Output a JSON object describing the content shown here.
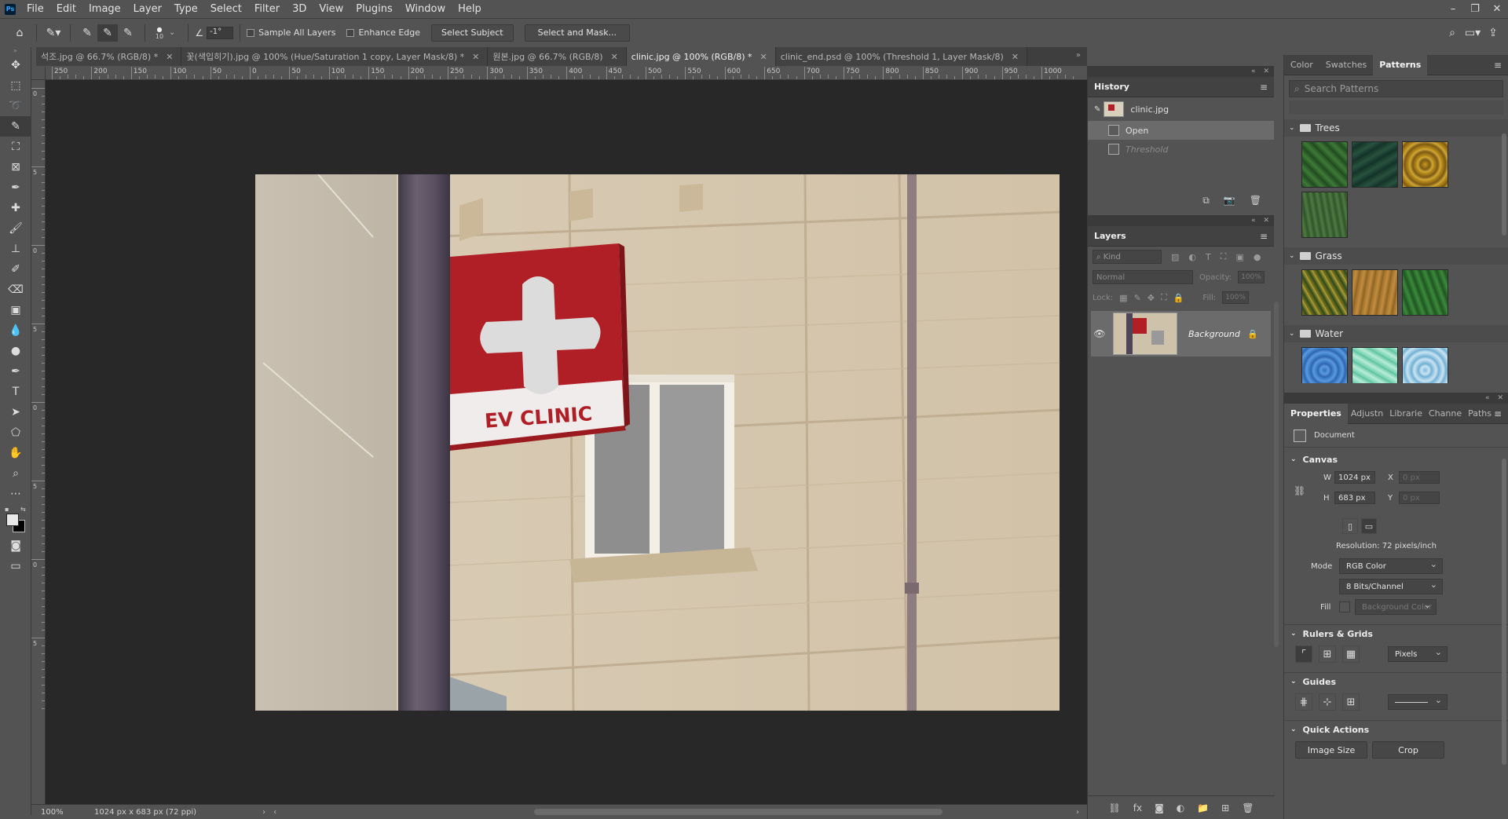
{
  "app": {
    "logo": "Ps"
  },
  "menu": [
    "File",
    "Edit",
    "Image",
    "Layer",
    "Type",
    "Select",
    "Filter",
    "3D",
    "View",
    "Plugins",
    "Window",
    "Help"
  ],
  "options": {
    "brush_size": "10",
    "angle": "-1°",
    "sample_all_layers": "Sample All Layers",
    "enhance_edge": "Enhance Edge",
    "select_subject": "Select Subject",
    "select_and_mask": "Select and Mask..."
  },
  "tabs": [
    {
      "label": "석조.jpg @ 66.7% (RGB/8) *",
      "active": false
    },
    {
      "label": "꽃(색입히기).jpg @ 100% (Hue/Saturation 1 copy, Layer Mask/8) *",
      "active": false
    },
    {
      "label": "원본.jpg @ 66.7% (RGB/8)",
      "active": false
    },
    {
      "label": "clinic.jpg @ 100% (RGB/8) *",
      "active": true
    },
    {
      "label": "clinic_end.psd @ 100% (Threshold 1, Layer Mask/8)",
      "active": false
    }
  ],
  "ruler": {
    "top": [
      "250",
      "200",
      "150",
      "100",
      "50",
      "0",
      "50",
      "100",
      "150",
      "200",
      "250",
      "300",
      "350",
      "400",
      "450",
      "500",
      "550",
      "600",
      "650",
      "700",
      "750",
      "800",
      "850",
      "900",
      "950",
      "1000"
    ],
    "left": [
      "0",
      "5",
      "0",
      "5",
      "0",
      "5",
      "0",
      "5"
    ]
  },
  "image": {
    "sign_text": "EV CLINIC"
  },
  "status": {
    "zoom": "100%",
    "doc_info": "1024 px x 683 px (72 ppi)"
  },
  "history": {
    "title": "History",
    "snapshot": "clinic.jpg",
    "items": [
      {
        "label": "Open",
        "selected": true
      },
      {
        "label": "Threshold",
        "selected": false
      }
    ]
  },
  "layers": {
    "title": "Layers",
    "kind": "Kind",
    "blend": "Normal",
    "opacity_label": "Opacity:",
    "opacity": "100%",
    "lock_label": "Lock:",
    "fill_label": "Fill:",
    "fill": "100%",
    "items": [
      {
        "name": "Background"
      }
    ]
  },
  "patterns": {
    "tabs": [
      "Color",
      "Swatches",
      "Patterns"
    ],
    "active_tab": "Patterns",
    "search_placeholder": "Search Patterns",
    "groups": [
      {
        "name": "Trees",
        "swatches": [
          "#2f5d2a",
          "#1d3d34",
          "#b58a1e",
          "#3e5e34"
        ]
      },
      {
        "name": "Grass",
        "swatches": [
          "#9a8a2c",
          "#a8792f",
          "#2b6a2d"
        ]
      },
      {
        "name": "Water",
        "swatches": [
          "#3f7fc4",
          "#6fcfae",
          "#8fc2de"
        ]
      }
    ]
  },
  "properties": {
    "tabs": [
      "Properties",
      "Adjustn",
      "Librarie",
      "Channe",
      "Paths"
    ],
    "active_tab": "Properties",
    "type": "Document",
    "canvas_label": "Canvas",
    "w_label": "W",
    "w": "1024 px",
    "h_label": "H",
    "h": "683 px",
    "x_label": "X",
    "x": "0 px",
    "y_label": "Y",
    "y": "0 px",
    "resolution": "Resolution: 72 pixels/inch",
    "mode_label": "Mode",
    "mode": "RGB Color",
    "bits": "8 Bits/Channel",
    "fill_label": "Fill",
    "fill": "Background Color",
    "rulers_label": "Rulers & Grids",
    "units": "Pixels",
    "guides_label": "Guides",
    "quick_actions_label": "Quick Actions",
    "image_size": "Image Size",
    "crop": "Crop"
  }
}
